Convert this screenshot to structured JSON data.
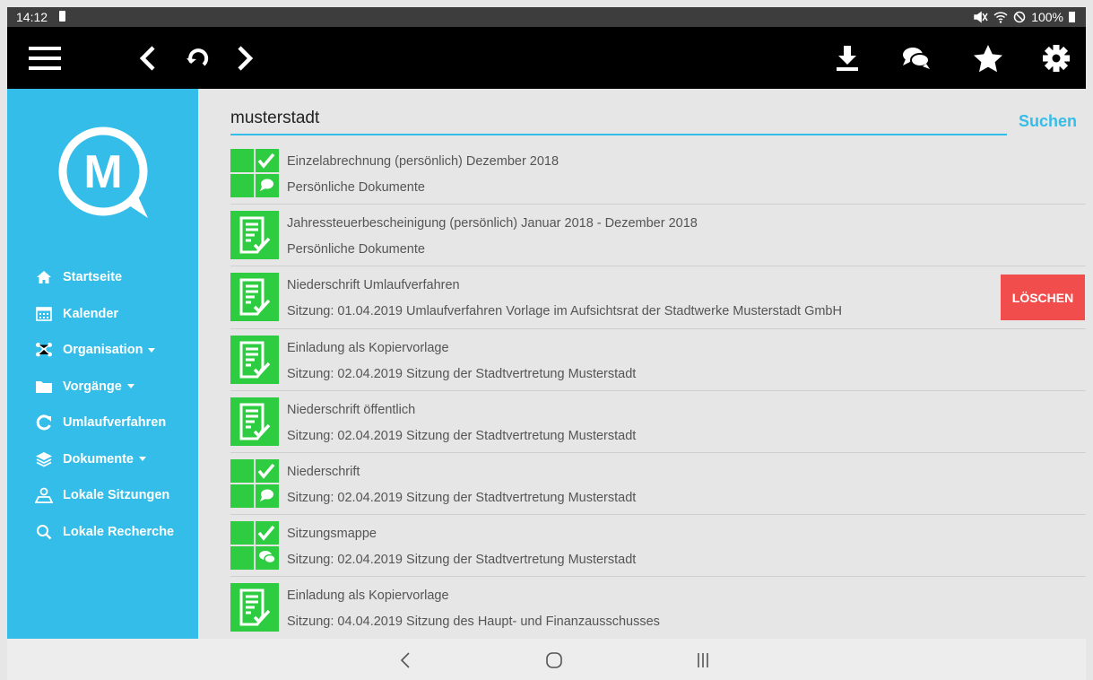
{
  "status_bar": {
    "time": "14:12",
    "battery": "100%"
  },
  "toolbar": {
    "icons": [
      "menu-icon",
      "back-icon",
      "reload-icon",
      "forward-icon",
      "download-icon",
      "chat-icon",
      "star-icon",
      "gear-icon"
    ]
  },
  "sidebar": {
    "logo_letter": "M",
    "items": [
      {
        "label": "Startseite",
        "icon": "home-icon",
        "dropdown": false
      },
      {
        "label": "Kalender",
        "icon": "calendar-icon",
        "dropdown": false
      },
      {
        "label": "Organisation",
        "icon": "organisation-icon",
        "dropdown": true
      },
      {
        "label": "Vorgänge",
        "icon": "folder-icon",
        "dropdown": true
      },
      {
        "label": "Umlaufverfahren",
        "icon": "refresh-icon",
        "dropdown": false
      },
      {
        "label": "Dokumente",
        "icon": "layers-icon",
        "dropdown": true
      },
      {
        "label": "Lokale Sitzungen",
        "icon": "map-person-icon",
        "dropdown": false
      },
      {
        "label": "Lokale Recherche",
        "icon": "search-icon",
        "dropdown": false
      }
    ]
  },
  "search": {
    "value": "musterstadt",
    "button_label": "Suchen"
  },
  "results": [
    {
      "title": "Einzelabrechnung (persönlich) Dezember 2018",
      "subtitle": "Persönliche Dokumente",
      "thumb": "grid"
    },
    {
      "title": "Jahressteuerbescheinigung (persönlich) Januar 2018 - Dezember 2018",
      "subtitle": "Persönliche Dokumente",
      "thumb": "doc"
    },
    {
      "title": "Niederschrift Umlaufverfahren",
      "subtitle": "Sitzung: 01.04.2019 Umlaufverfahren Vorlage im Aufsichtsrat der Stadtwerke Musterstadt GmbH",
      "thumb": "doc",
      "delete_label": "LÖSCHEN"
    },
    {
      "title": "Einladung als Kopiervorlage",
      "subtitle": "Sitzung: 02.04.2019 Sitzung der Stadtvertretung Musterstadt",
      "thumb": "doc"
    },
    {
      "title": "Niederschrift öffentlich",
      "subtitle": "Sitzung: 02.04.2019 Sitzung der Stadtvertretung Musterstadt",
      "thumb": "doc"
    },
    {
      "title": "Niederschrift",
      "subtitle": "Sitzung: 02.04.2019 Sitzung der Stadtvertretung Musterstadt",
      "thumb": "grid"
    },
    {
      "title": "Sitzungsmappe",
      "subtitle": "Sitzung: 02.04.2019 Sitzung der Stadtvertretung Musterstadt",
      "thumb": "grid"
    },
    {
      "title": "Einladung als Kopiervorlage",
      "subtitle": "Sitzung: 04.04.2019 Sitzung des Haupt- und Finanzausschusses",
      "thumb": "doc"
    }
  ],
  "colors": {
    "accent": "#33bde8",
    "green": "#2ecc40",
    "delete": "#f24d4d",
    "toolbar": "#000000"
  }
}
